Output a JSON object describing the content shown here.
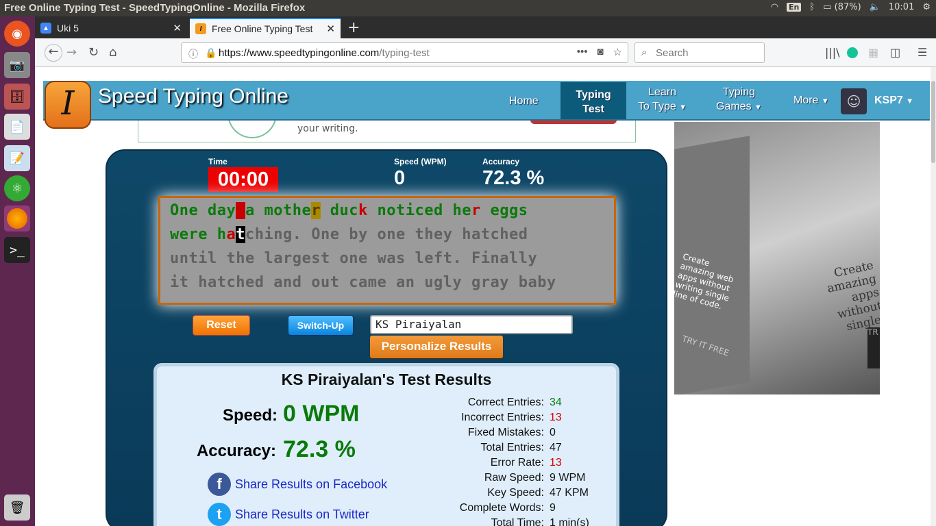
{
  "os": {
    "window_title": "Free Online Typing Test - SpeedTypingOnline - Mozilla Firefox",
    "keyboard_layout": "En",
    "battery": "(87%)",
    "clock": "10:01"
  },
  "browser": {
    "tabs": [
      {
        "label": "Uki 5",
        "active": false
      },
      {
        "label": "Free Online Typing Test",
        "active": true
      }
    ],
    "url_host": "https://www.speedtypingonline.com",
    "url_path": "/typing-test",
    "search_placeholder": "Search"
  },
  "site": {
    "logo_letter": "I",
    "name": "Speed Typing Online",
    "nav": {
      "home": "Home",
      "typing1": "Typing",
      "typing2": "Test",
      "learn1": "Learn",
      "learn2": "To Type",
      "games1": "Typing",
      "games2": "Games",
      "more": "More",
      "user": "KSP7"
    },
    "ad_text": "your writing."
  },
  "right_ad": {
    "caption_left": "Create amazing web apps without writing single line of code.",
    "caption_right": "Create amazing apps without singlel",
    "cta": "TRY IT FREE",
    "cta_cut": "TR"
  },
  "test": {
    "time_label": "Time",
    "time": "00:00",
    "speed_label": "Speed (WPM)",
    "speed": "0",
    "accuracy_label": "Accuracy",
    "accuracy": "72.3 %",
    "lines": [
      "One day a mother duck noticed her eggs",
      "were hatching. One by one they hatched",
      "until the largest one was left. Finally",
      "it hatched and out came an ugly gray baby"
    ],
    "reset": "Reset",
    "switch_up": "Switch-Up",
    "name_value": "KS Piraiyalan",
    "personalize": "Personalize Results"
  },
  "results": {
    "title": "KS Piraiyalan's Test Results",
    "speed_label": "Speed:",
    "speed_value": "0 WPM",
    "accuracy_label": "Accuracy:",
    "accuracy_value": "72.3 %",
    "share_fb": "Share Results on Facebook",
    "share_tw": "Share Results on Twitter",
    "stats": [
      {
        "label": "Correct Entries:",
        "value": "34",
        "color": "green"
      },
      {
        "label": "Incorrect Entries:",
        "value": "13",
        "color": "red"
      },
      {
        "label": "Fixed Mistakes:",
        "value": "0",
        "color": "black"
      },
      {
        "label": "Total Entries:",
        "value": "47",
        "color": "black"
      },
      {
        "label": "Error Rate:",
        "value": "13",
        "color": "red"
      },
      {
        "label": "Raw Speed:",
        "value": "9 WPM",
        "color": "black"
      },
      {
        "label": "Key Speed:",
        "value": "47 KPM",
        "color": "black"
      },
      {
        "label": "Complete Words:",
        "value": "9",
        "color": "black"
      },
      {
        "label": "Total Time:",
        "value": "1 min(s)",
        "color": "black"
      }
    ]
  }
}
